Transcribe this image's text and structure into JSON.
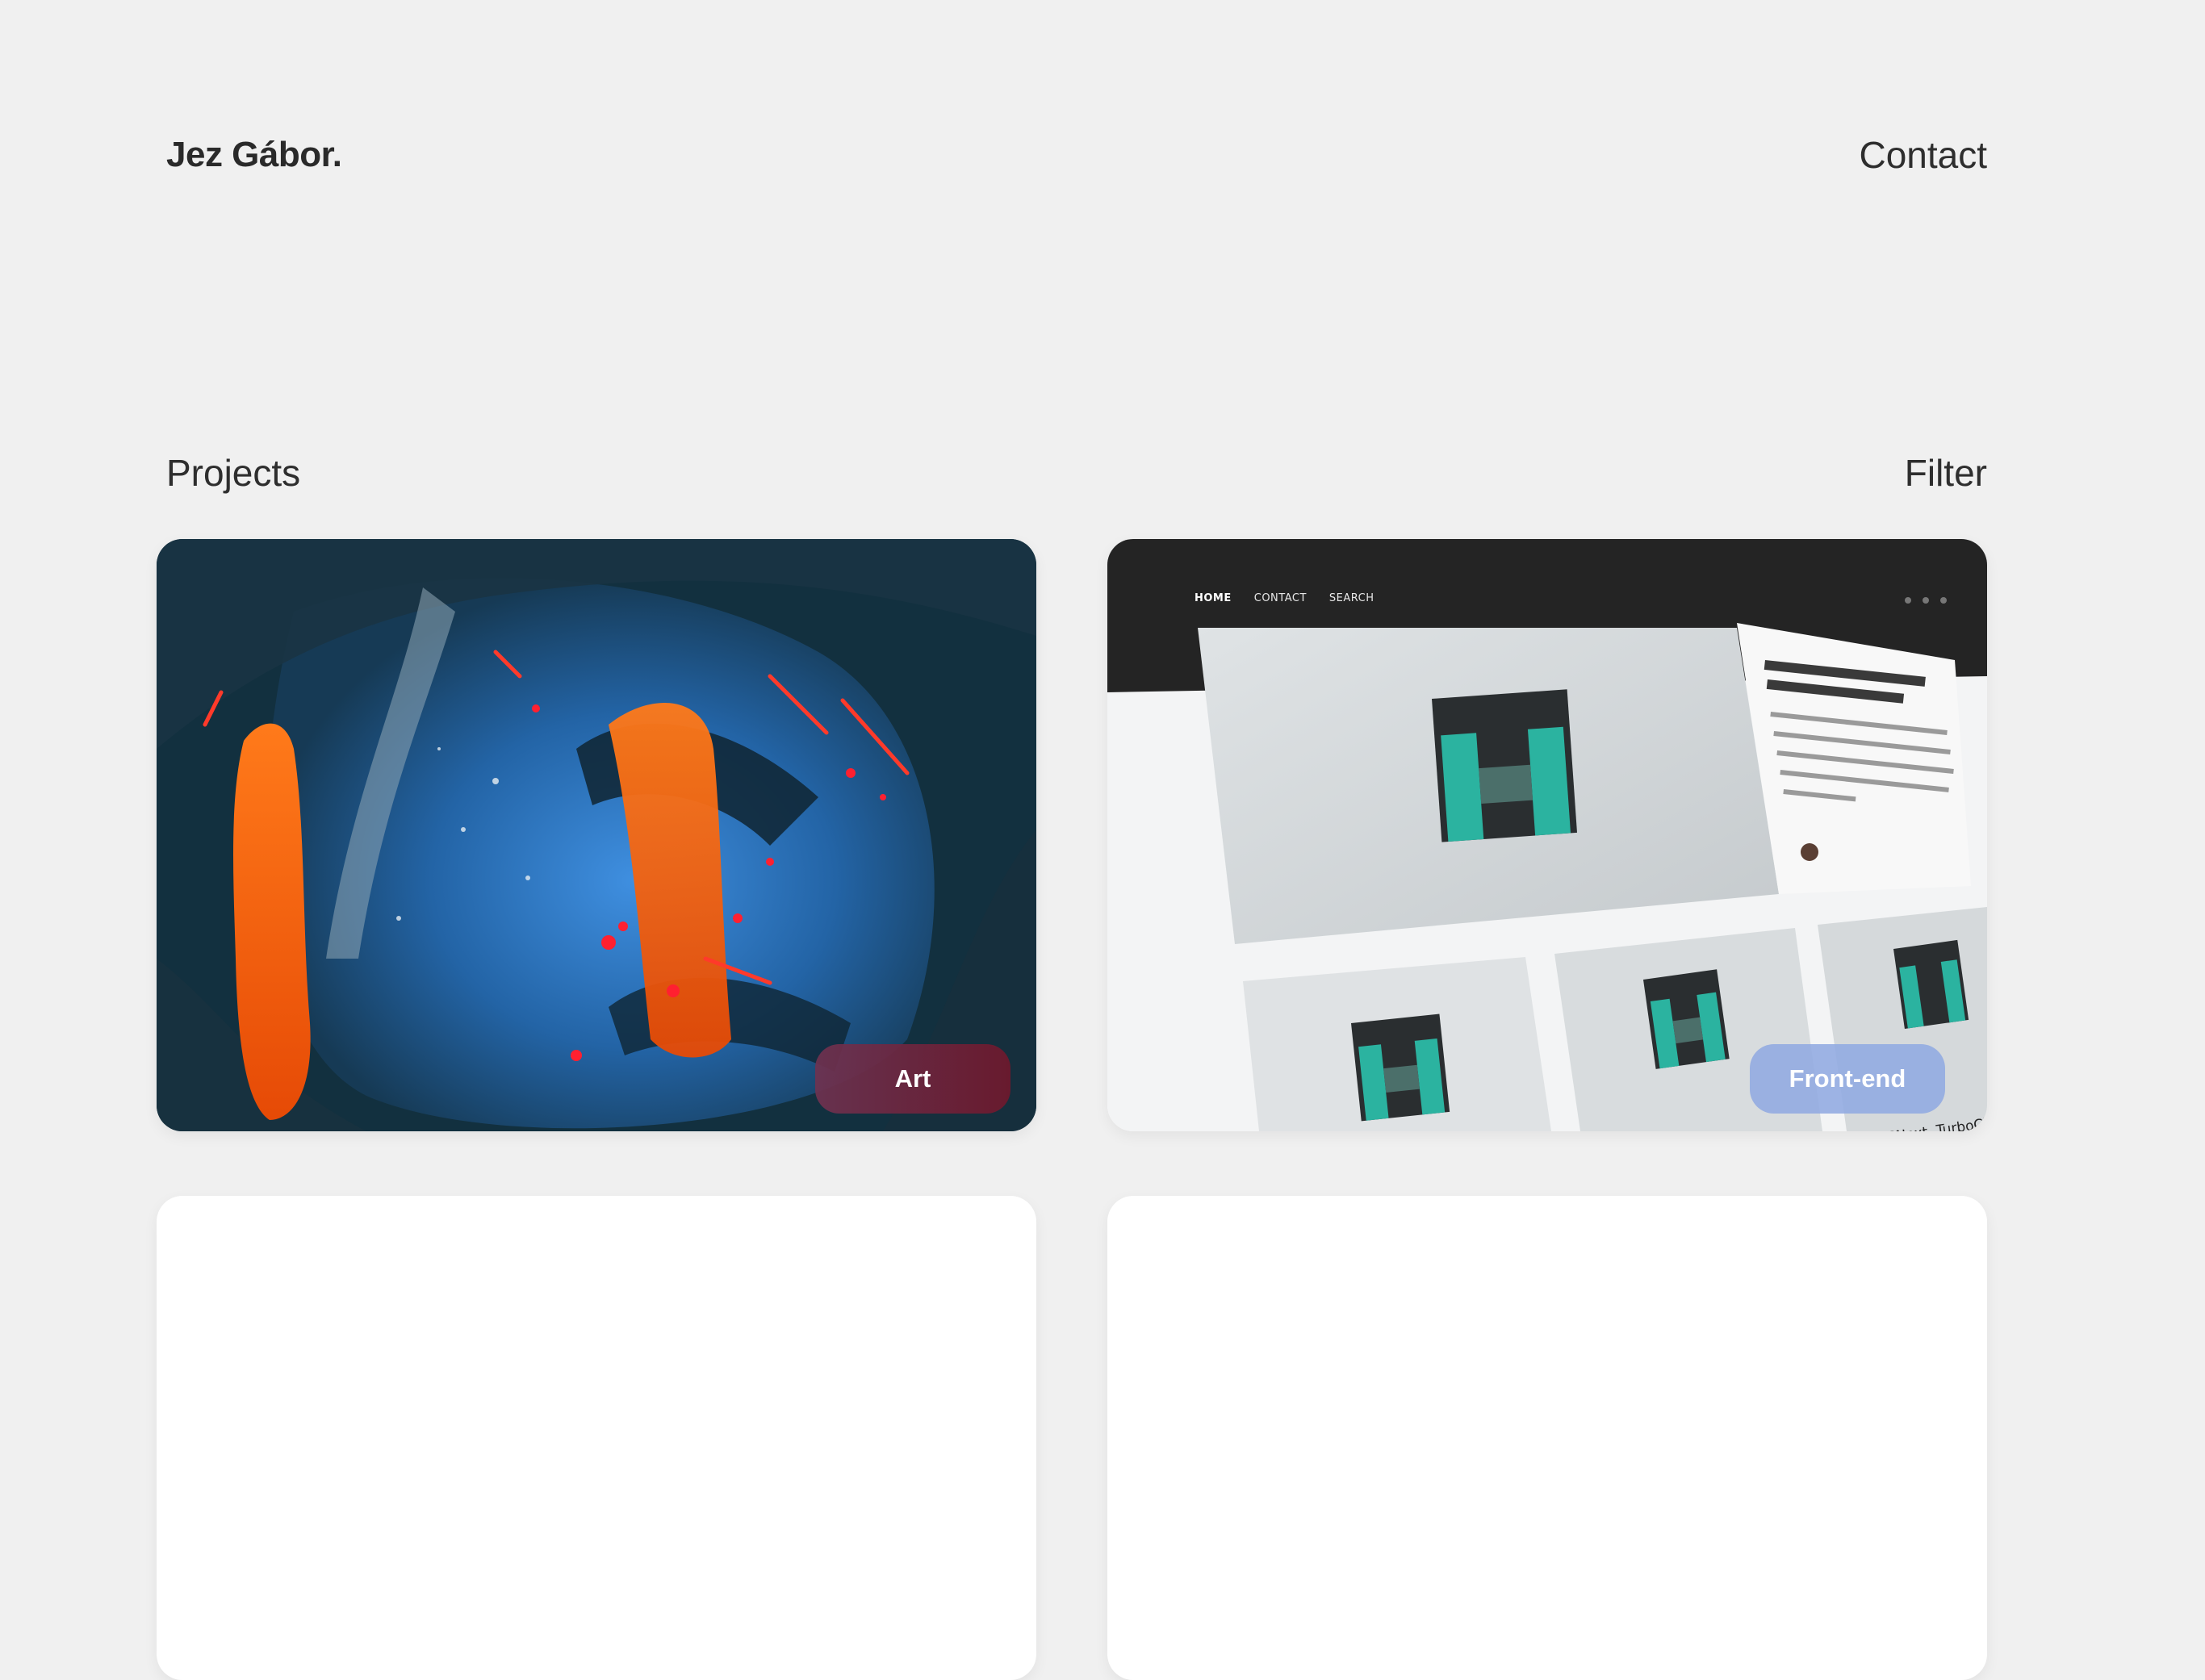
{
  "header": {
    "brand": "Jez Gábor.",
    "contact_label": "Contact"
  },
  "projects": {
    "title": "Projects",
    "filter_label": "Filter",
    "cards": [
      {
        "image": "abstract-painting-blue-orange",
        "tag": "Art",
        "tag_color": "#6c2038"
      },
      {
        "image": "website-mockup-screens",
        "tag": "Front-end",
        "tag_color": "#91aae1",
        "mockup": {
          "nav": [
            "HOME",
            "CONTACT",
            "SEARCH"
          ],
          "caption": "CSSNext, TurboCli"
        }
      },
      {
        "image": "empty"
      },
      {
        "image": "empty"
      }
    ]
  },
  "colors": {
    "background": "#f0f0f0",
    "text": "#2a2a2a",
    "card": "#ffffff",
    "accent_teal": "#2bb3a0"
  }
}
